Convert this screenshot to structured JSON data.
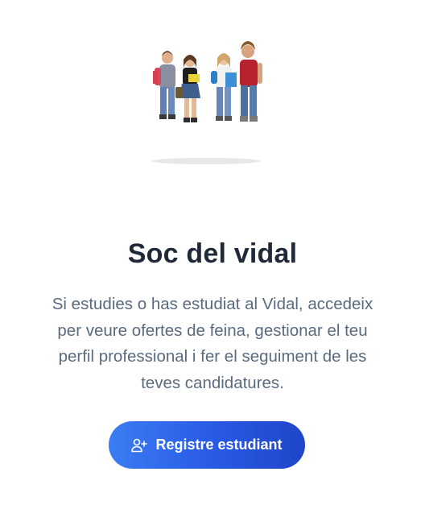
{
  "card": {
    "illustration_icon": "students-group-photo",
    "title": "Soc del vidal",
    "description": "Si estudies o has estudiat al Vidal, accedeix per veure ofertes de feina, gestionar el teu perfil professional i fer el seguiment de les teves candidatures.",
    "button_label": "Registre estudiant",
    "button_icon": "user-plus-icon",
    "accent_color": "#2a5ce6"
  }
}
